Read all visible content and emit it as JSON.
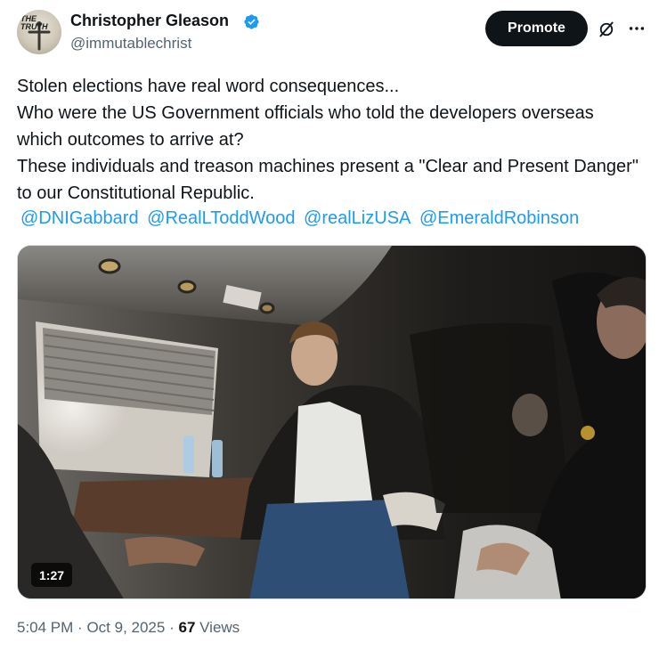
{
  "author": {
    "name": "Christopher Gleason",
    "handle": "@immutablechrist",
    "avatar_text": "THE TRUTH"
  },
  "header": {
    "promote_label": "Promote",
    "grok_icon": "grok-icon",
    "more_icon": "more-icon"
  },
  "tweet": {
    "lines": [
      "Stolen elections have real word consequences...",
      "Who were the US Government officials who told the developers overseas which outcomes to arrive at?",
      "These individuals and treason machines present a \"Clear and Present Danger\" to our Constitutional Republic."
    ],
    "mentions": [
      "@DNIGabbard",
      "@RealLToddWood",
      "@realLizUSA",
      "@EmeraldRobinson"
    ]
  },
  "video": {
    "duration": "1:27"
  },
  "meta": {
    "time": "5:04 PM",
    "separator": "·",
    "date": "Oct 9, 2025",
    "views_count": "67",
    "views_label": "Views"
  },
  "colors": {
    "link": "#1d9bf0",
    "verified": "#1d9bf0",
    "secondary_text": "#536471",
    "primary_text": "#0f1419"
  }
}
